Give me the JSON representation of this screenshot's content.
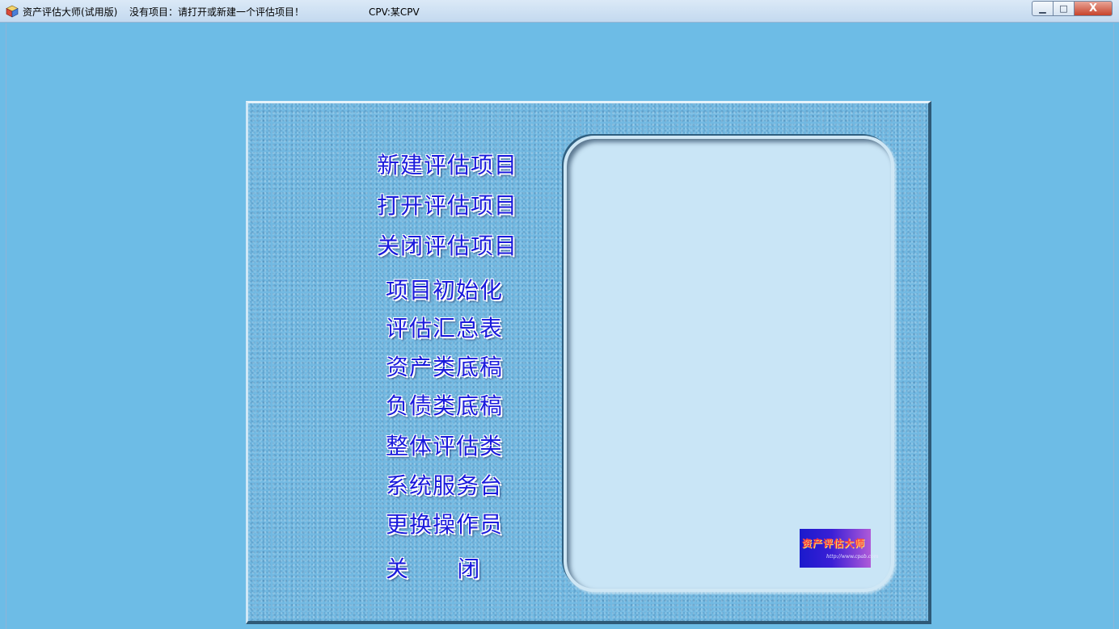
{
  "window": {
    "app_title": "资产评估大师(试用版)",
    "project_status": "没有项目：请打开或新建一个评估项目！",
    "cpv_label": "CPV:某CPV",
    "controls": {
      "minimize": "▁",
      "maximize": "□",
      "close": "X"
    },
    "background_color": "#6dbce6",
    "icon": "app-cube-icon"
  },
  "menu": {
    "text_color": "#1a1adc",
    "items": [
      "新建评估项目",
      "打开评估项目",
      "关闭评估项目",
      "项目初始化",
      "评估汇总表",
      "资产类底稿",
      "负债类底稿",
      "整体评估类",
      "系统服务台",
      "更换操作员",
      "关      闭"
    ]
  },
  "logo": {
    "title": "资产评估大师",
    "url": "http://www.cpab.com"
  }
}
